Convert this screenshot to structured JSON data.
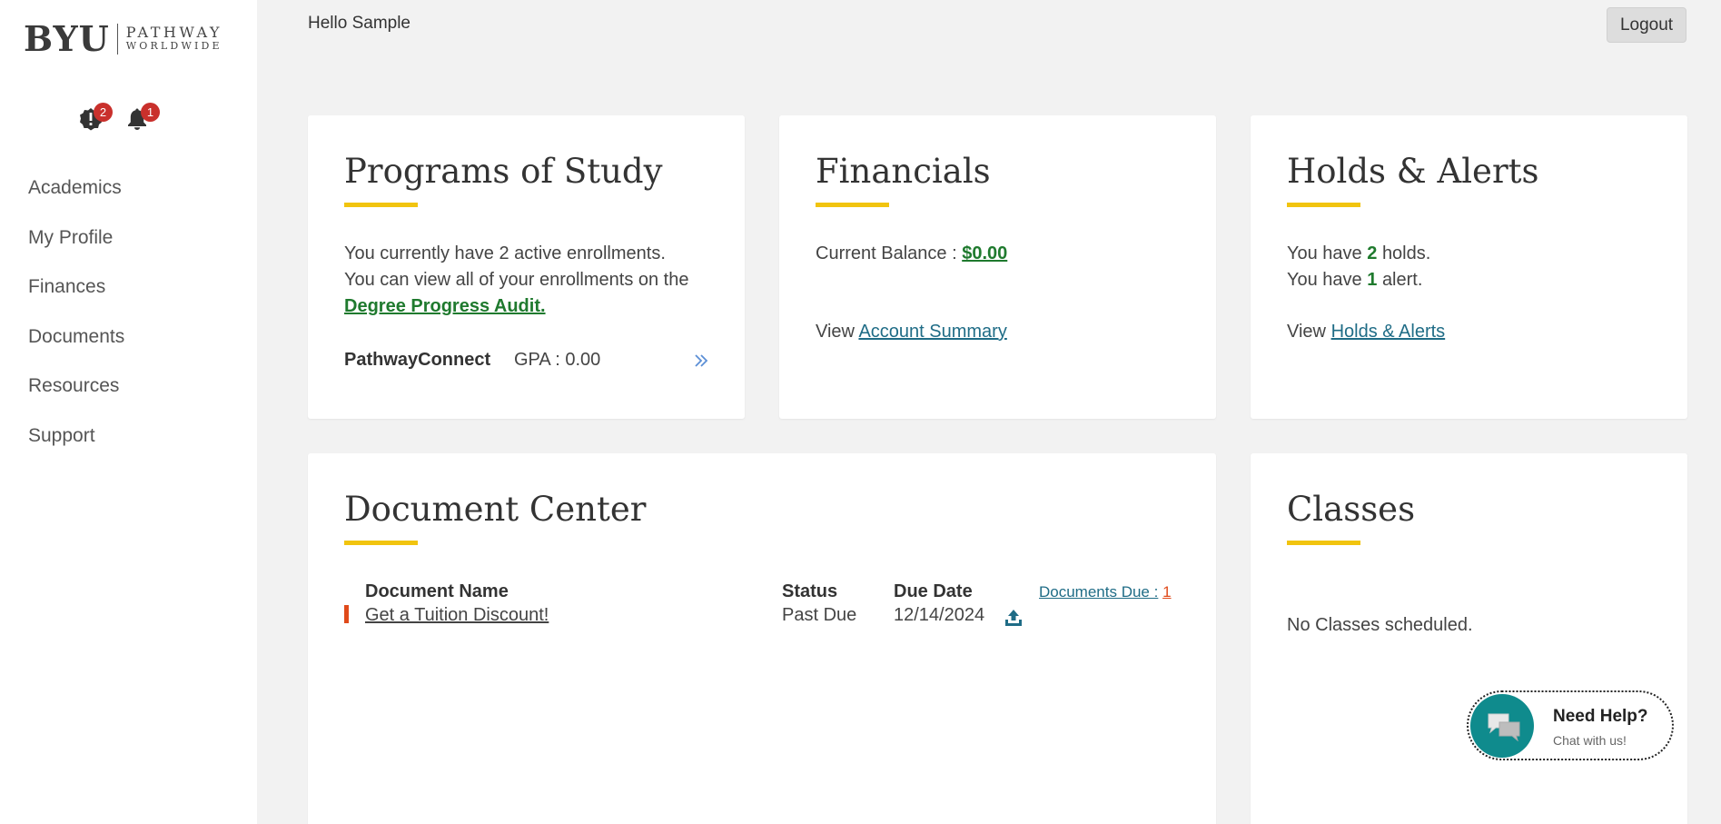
{
  "logo": {
    "mark": "BYU",
    "line1": "PATHWAY",
    "line2": "WORLDWIDE"
  },
  "icons": {
    "holds": {
      "name": "exclamation-icon",
      "count": "2"
    },
    "alerts": {
      "name": "bell-icon",
      "count": "1"
    }
  },
  "nav": [
    "Academics",
    "My Profile",
    "Finances",
    "Documents",
    "Resources",
    "Support"
  ],
  "header": {
    "greeting": "Hello Sample",
    "logout": "Logout"
  },
  "programs": {
    "title": "Programs of Study",
    "line1": "You currently have 2 active enrollments.",
    "line2": "You can view all of your enrollments on the",
    "link": "Degree Progress Audit.",
    "program_name": "PathwayConnect",
    "gpa": "GPA : 0.00"
  },
  "financials": {
    "title": "Financials",
    "balance_label": "Current Balance :",
    "balance_value": "$0.00",
    "view_label": "View",
    "view_link": "Account Summary"
  },
  "holds_alerts": {
    "title": "Holds & Alerts",
    "holds_pre": "You have",
    "holds_count": "2",
    "holds_post": "holds.",
    "alerts_pre": "You have",
    "alerts_count": "1",
    "alerts_post": "alert.",
    "view_label": "View",
    "view_link": "Holds & Alerts"
  },
  "document_center": {
    "title": "Document Center",
    "columns": [
      "Document Name",
      "Status",
      "Due Date"
    ],
    "due_link_label": "Documents Due :",
    "due_link_count": "1",
    "rows": [
      {
        "name": "Get a Tuition Discount!",
        "status": "Past Due",
        "due": "12/14/2024"
      }
    ]
  },
  "classes": {
    "title": "Classes",
    "empty": "No Classes scheduled."
  },
  "help": {
    "title": "Need Help?",
    "subtitle": "Chat with us!"
  },
  "colors": {
    "accent": "#f1c40f",
    "link": "#1f6c86",
    "positive": "#1f7a2e",
    "badge": "#c9302c",
    "chat": "#0f8b8d"
  }
}
